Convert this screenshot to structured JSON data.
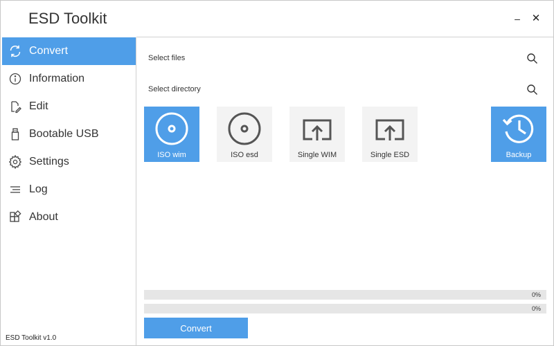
{
  "app": {
    "title": "ESD Toolkit",
    "minimize_glyph": "–",
    "close_glyph": "✕",
    "footer": "ESD Toolkit v1.0"
  },
  "colors": {
    "accent": "#4f9ee8",
    "tile_bg": "#f3f3f3",
    "progress_bg": "#e6e6e6"
  },
  "sidebar": {
    "items": [
      {
        "label": "Convert",
        "icon": "refresh-icon",
        "active": true
      },
      {
        "label": "Information",
        "icon": "info-icon",
        "active": false
      },
      {
        "label": "Edit",
        "icon": "edit-icon",
        "active": false
      },
      {
        "label": "Bootable USB",
        "icon": "usb-icon",
        "active": false
      },
      {
        "label": "Settings",
        "icon": "gear-icon",
        "active": false
      },
      {
        "label": "Log",
        "icon": "log-icon",
        "active": false
      },
      {
        "label": "About",
        "icon": "about-icon",
        "active": false
      }
    ]
  },
  "fields": {
    "files": {
      "label": "Select files",
      "icon": "search-icon"
    },
    "directory": {
      "label": "Select directory",
      "icon": "search-icon"
    }
  },
  "tiles": [
    {
      "label": "ISO wim",
      "icon": "disc-icon",
      "selected": true
    },
    {
      "label": "ISO esd",
      "icon": "disc-icon",
      "selected": false
    },
    {
      "label": "Single WIM",
      "icon": "export-icon",
      "selected": false
    },
    {
      "label": "Single ESD",
      "icon": "export-icon",
      "selected": false
    },
    {
      "label": "Backup",
      "icon": "history-icon",
      "selected": true
    }
  ],
  "progress": [
    {
      "label": "0%",
      "value": 0
    },
    {
      "label": "0%",
      "value": 0
    }
  ],
  "actions": {
    "convert_label": "Convert"
  }
}
